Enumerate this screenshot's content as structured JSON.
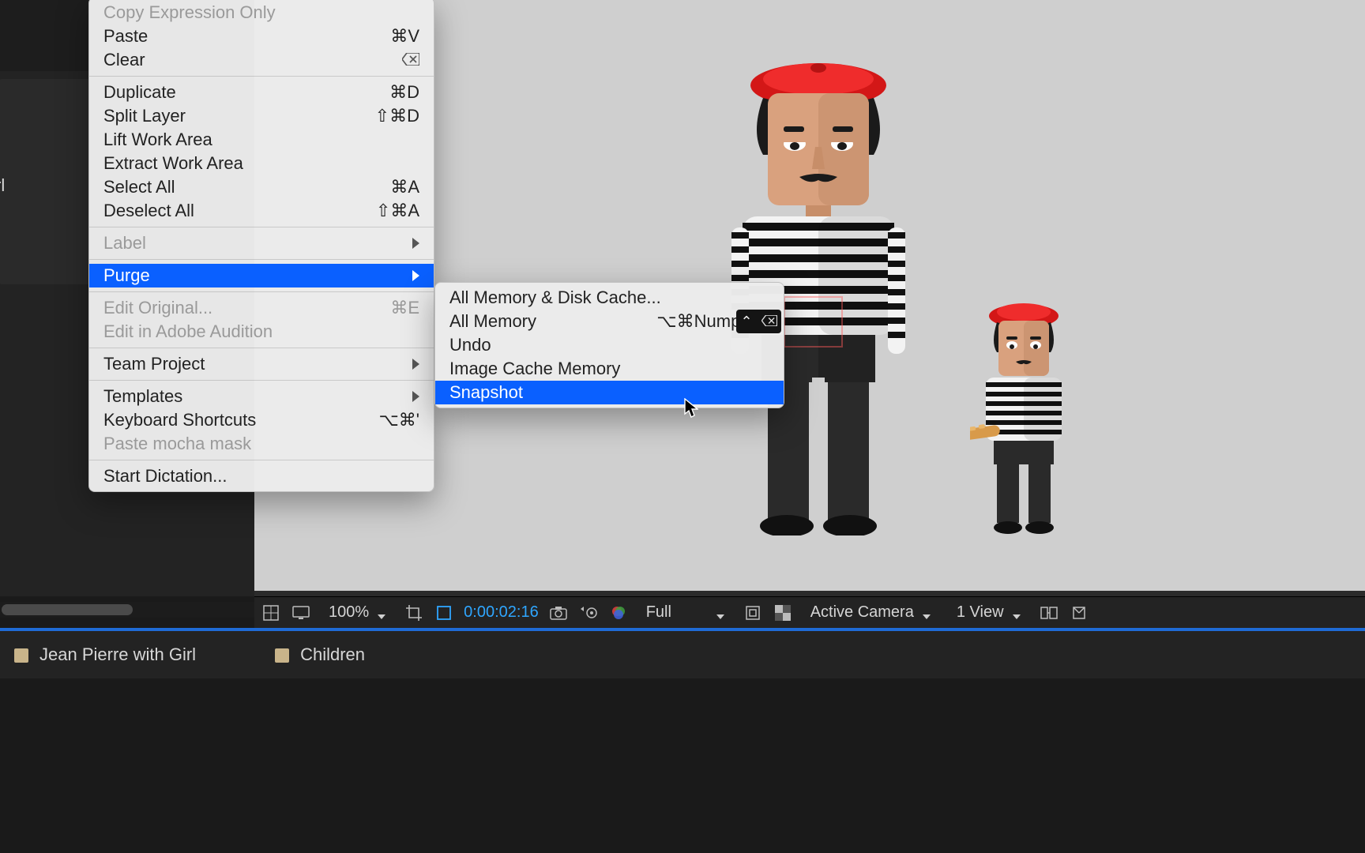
{
  "left_panel": {
    "visible_label": "rl"
  },
  "menu": {
    "top_truncated": "Copy Expression Only",
    "items": [
      {
        "label": "Paste",
        "shortcut": "⌘V"
      },
      {
        "label": "Clear",
        "shortcut": "⌫"
      }
    ],
    "group2": [
      {
        "label": "Duplicate",
        "shortcut": "⌘D"
      },
      {
        "label": "Split Layer",
        "shortcut": "⇧⌘D"
      },
      {
        "label": "Lift Work Area",
        "shortcut": ""
      },
      {
        "label": "Extract Work Area",
        "shortcut": ""
      },
      {
        "label": "Select All",
        "shortcut": "⌘A"
      },
      {
        "label": "Deselect All",
        "shortcut": "⇧⌘A"
      }
    ],
    "label_item": {
      "label": "Label"
    },
    "purge": {
      "label": "Purge"
    },
    "group3": [
      {
        "label": "Edit Original...",
        "shortcut": "⌘E",
        "disabled": true
      },
      {
        "label": "Edit in Adobe Audition",
        "shortcut": "",
        "disabled": true
      }
    ],
    "team_project": {
      "label": "Team Project"
    },
    "group4": [
      {
        "label": "Templates"
      },
      {
        "label": "Keyboard Shortcuts",
        "shortcut": "⌥⌘'"
      },
      {
        "label": "Paste mocha mask",
        "disabled": true
      }
    ],
    "start_dictation": {
      "label": "Start Dictation..."
    }
  },
  "submenu": {
    "items": [
      {
        "label": "All Memory & Disk Cache...",
        "shortcut": ""
      },
      {
        "label": "All Memory",
        "shortcut": "⌥⌘Numpad /"
      },
      {
        "label": "Undo",
        "shortcut": ""
      },
      {
        "label": "Image Cache Memory",
        "shortcut": ""
      },
      {
        "label": "Snapshot",
        "shortcut": "",
        "highlight": true
      }
    ]
  },
  "float_panel": {
    "chev": "⌃",
    "x": "⌫"
  },
  "toolbar": {
    "zoom": "100%",
    "timecode": "0:00:02:16",
    "resolution": "Full",
    "camera": "Active Camera",
    "views": "1 View"
  },
  "comps": [
    {
      "name": "Jean Pierre with Girl"
    },
    {
      "name": "Children"
    }
  ]
}
